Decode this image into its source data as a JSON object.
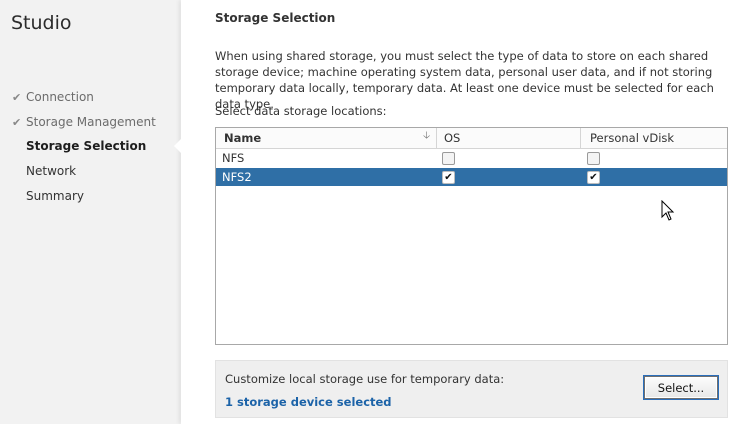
{
  "app": {
    "title": "Studio"
  },
  "nav": [
    {
      "label": "Connection",
      "state": "done"
    },
    {
      "label": "Storage Management",
      "state": "done"
    },
    {
      "label": "Storage Selection",
      "state": "current"
    },
    {
      "label": "Network",
      "state": "pending"
    },
    {
      "label": "Summary",
      "state": "pending"
    }
  ],
  "page": {
    "title": "Storage Selection",
    "description": "When using shared storage, you must select the type of data to store on each shared storage device; machine operating system data, personal user data, and if not storing temporary data locally, temporary data. At least one device must be selected for each data type.",
    "locations_label": "Select data storage locations:"
  },
  "table": {
    "columns": [
      "Name",
      "OS",
      "Personal vDisk"
    ],
    "rows": [
      {
        "name": "NFS",
        "os": false,
        "vdisk": false,
        "selected": false
      },
      {
        "name": "NFS2",
        "os": true,
        "vdisk": true,
        "selected": true
      }
    ]
  },
  "temp_storage": {
    "label": "Customize local storage use for temporary data:",
    "link": "1 storage device selected",
    "button": "Select..."
  },
  "icons": {
    "check": "checkmark-icon",
    "sort": "sort-down-icon",
    "cursor": "mouse-cursor-icon"
  },
  "colors": {
    "selection": "#2f6fa6",
    "link": "#1c63a8"
  }
}
